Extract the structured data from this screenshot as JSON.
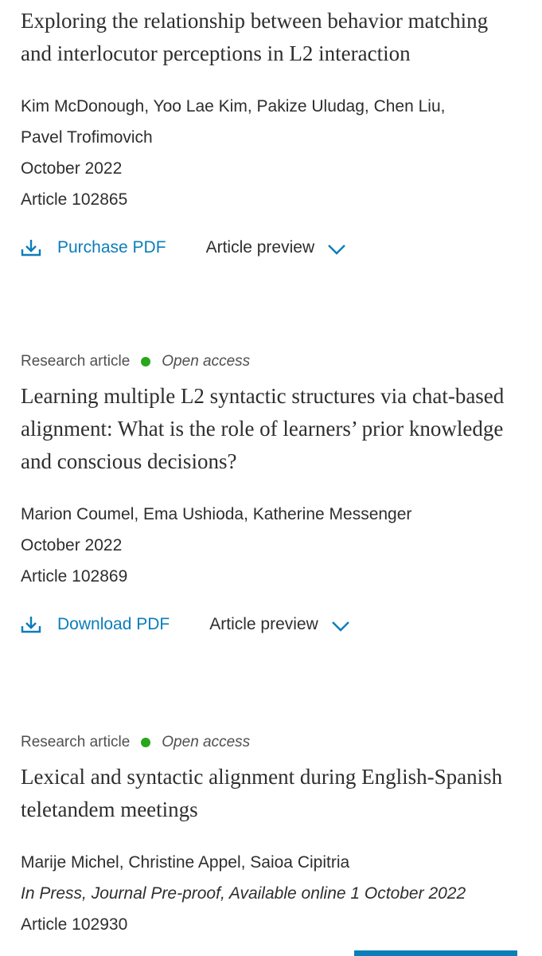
{
  "articles": [
    {
      "title": "Exploring the relationship between behavior matching and interlocutor perceptions in L2 interaction",
      "authors_line1": "Kim McDonough, Yoo Lae Kim, Pakize Uludag, Chen Liu,",
      "authors_line2": "Pavel Trofimovich",
      "date": "October 2022",
      "article_no": "Article 102865",
      "pdf_label": "Purchase PDF",
      "preview_label": "Article preview"
    },
    {
      "type_label": "Research article",
      "access_label": "Open access",
      "title": "Learning multiple L2 syntactic structures via chat-based alignment: What is the role of learners’ prior knowledge and conscious decisions?",
      "authors_line1": "Marion Coumel, Ema Ushioda, Katherine Messenger",
      "date": "October 2022",
      "article_no": "Article 102869",
      "pdf_label": "Download PDF",
      "preview_label": "Article preview"
    },
    {
      "type_label": "Research article",
      "access_label": "Open access",
      "title": "Lexical and syntactic alignment during English-Spanish teletandem meetings",
      "authors_line1": "Marije Michel, Christine Appel, Saioa Cipitria",
      "date": "In Press, Journal Pre-proof, Available online 1 October 2022",
      "article_no": "Article 102930"
    }
  ],
  "colors": {
    "link": "#0c7dbb",
    "open_access_dot": "#29a61b",
    "text": "#2e2e2e"
  },
  "icons": {
    "pdf": "download-icon",
    "preview": "chevron-down-icon"
  }
}
